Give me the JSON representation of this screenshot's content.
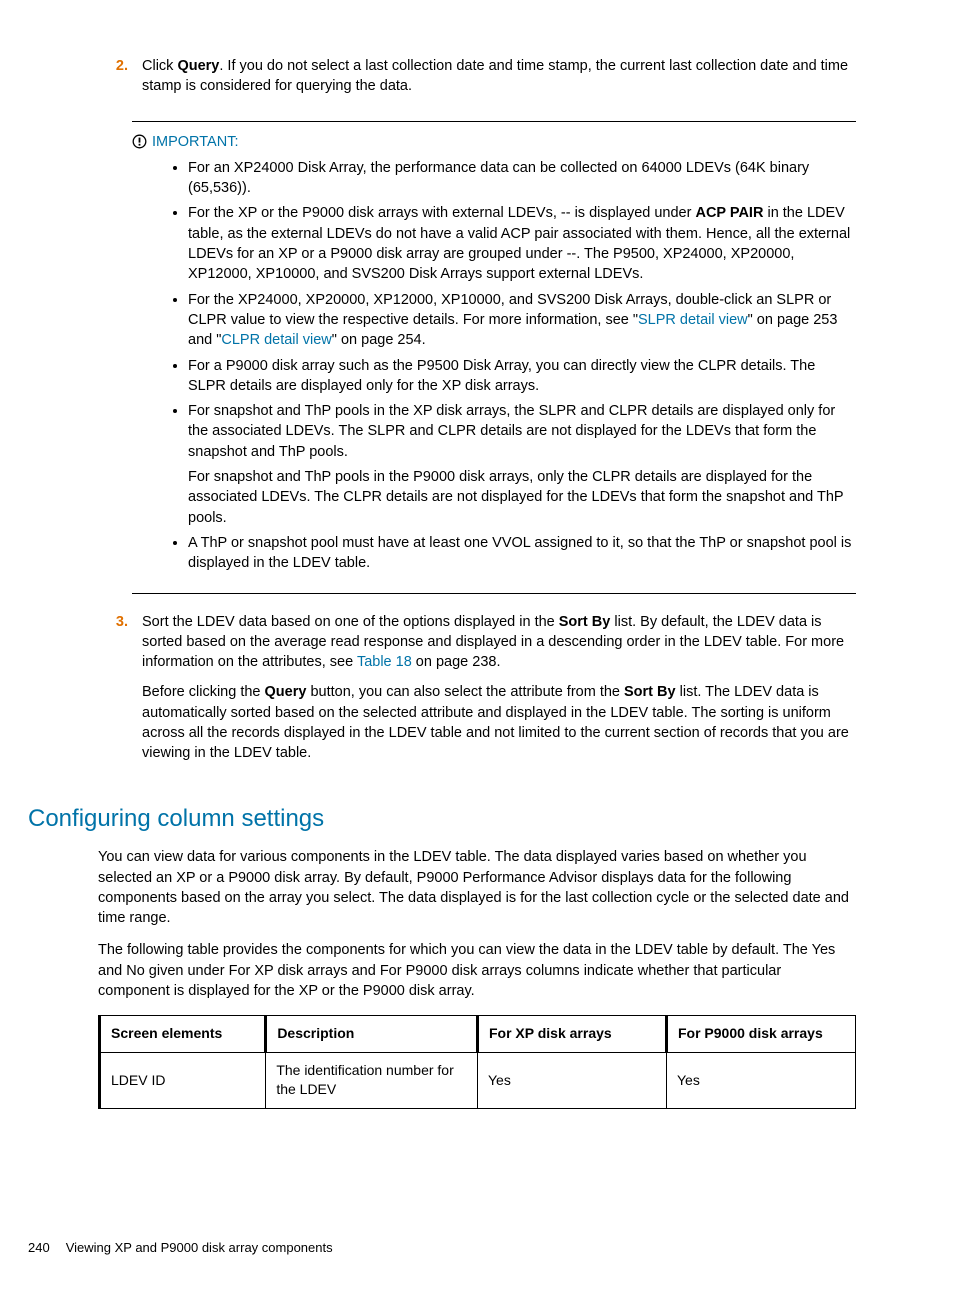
{
  "steps": {
    "s2": {
      "num": "2.",
      "body_a": "Click ",
      "body_b": "Query",
      "body_c": ". If you do not select a last collection date and time stamp, the current last collection date and time stamp is considered for querying the data."
    },
    "s3": {
      "num": "3.",
      "p1_a": "Sort the LDEV data based on one of the options displayed in the ",
      "p1_b": "Sort By",
      "p1_c": " list. By default, the LDEV data is sorted based on the average read response and displayed in a descending order in the LDEV table. For more information on the attributes, see ",
      "p1_link": "Table 18",
      "p1_d": " on page 238.",
      "p2_a": "Before clicking the ",
      "p2_b": "Query",
      "p2_c": " button, you can also select the attribute from the ",
      "p2_d": "Sort By",
      "p2_e": " list. The LDEV data is automatically sorted based on the selected attribute and displayed in the LDEV table. The sorting is uniform across all the records displayed in the LDEV table and not limited to the current section of records that you are viewing in the LDEV table."
    }
  },
  "note": {
    "label": "IMPORTANT:",
    "b1": "For an XP24000 Disk Array, the performance data can be collected on 64000 LDEVs (64K binary (65,536)).",
    "b2_a": "For the XP or the P9000 disk arrays with external LDEVs, -- is displayed under ",
    "b2_b": "ACP PAIR",
    "b2_c": " in the LDEV table, as the external LDEVs do not have a valid ACP pair associated with them. Hence, all the external LDEVs for an XP or a P9000 disk array are grouped under --. The P9500, XP24000, XP20000, XP12000, XP10000, and SVS200 Disk Arrays support external LDEVs.",
    "b3_a": "For the XP24000, XP20000, XP12000, XP10000, and SVS200 Disk Arrays, double-click an SLPR or CLPR value to view the respective details. For more information, see \"",
    "b3_link1": "SLPR detail view",
    "b3_b": "\" on page 253 and \"",
    "b3_link2": "CLPR detail view",
    "b3_c": "\" on page 254.",
    "b4": "For a P9000 disk array such as the P9500 Disk Array, you can directly view the CLPR details. The SLPR details are displayed only for the XP disk arrays.",
    "b5_p1": "For snapshot and ThP pools in the XP disk arrays, the SLPR and CLPR details are displayed only for the associated LDEVs. The SLPR and CLPR details are not displayed for the LDEVs that form the snapshot and ThP pools.",
    "b5_p2": "For snapshot and ThP pools in the P9000 disk arrays, only the CLPR details are displayed for the associated LDEVs. The CLPR details are not displayed for the LDEVs that form the snapshot and ThP pools.",
    "b6": "A ThP or snapshot pool must have at least one VVOL assigned to it, so that the ThP or snapshot pool is displayed in the LDEV table."
  },
  "section": {
    "title": "Configuring column settings",
    "p1": "You can view data for various components in the LDEV table. The data displayed varies based on whether you selected an XP or a P9000 disk array. By default, P9000 Performance Advisor displays data for the following components based on the array you select. The data displayed is for the last collection cycle or the selected date and time range.",
    "p2": "The following table provides the components for which you can view the data in the LDEV table by default. The Yes and No given under For XP disk arrays and For P9000 disk arrays columns indicate whether that particular component is displayed for the XP or the P9000 disk array."
  },
  "table": {
    "h1": "Screen elements",
    "h2": "Description",
    "h3": "For XP disk arrays",
    "h4": "For P9000 disk arrays",
    "r1c1": "LDEV ID",
    "r1c2": "The identification number for the LDEV",
    "r1c3": "Yes",
    "r1c4": "Yes"
  },
  "footer": {
    "page": "240",
    "title": "Viewing XP and P9000 disk array components"
  }
}
